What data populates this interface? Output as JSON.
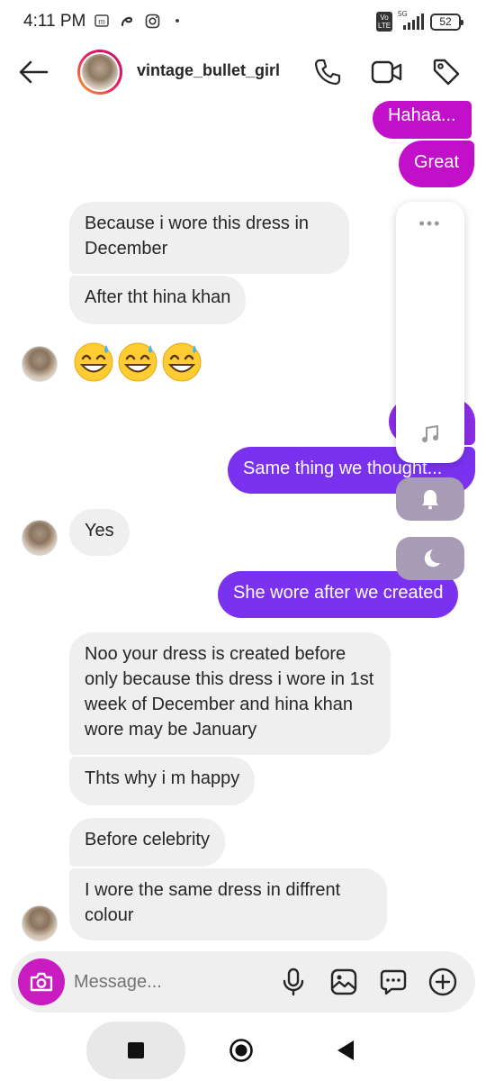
{
  "status_bar": {
    "time": "4:11 PM",
    "network": "5G",
    "volte": "Vo LTE",
    "battery": "52"
  },
  "header": {
    "username": "vintage_bullet_girl"
  },
  "messages": [
    {
      "sender": "me",
      "text": "Hahaa..."
    },
    {
      "sender": "me",
      "text": "Great"
    },
    {
      "sender": "them",
      "text": "Because i wore this dress in December"
    },
    {
      "sender": "them",
      "text": "After tht hina khan"
    },
    {
      "sender": "them",
      "text": "😅😅😅"
    },
    {
      "sender": "me",
      "text": "Same thing we thought..."
    },
    {
      "sender": "them",
      "text": "Yes"
    },
    {
      "sender": "me",
      "text": "She wore after we created"
    },
    {
      "sender": "them",
      "text": "Noo your dress is created before only because this dress i wore in 1st week of December and hina khan wore may be January"
    },
    {
      "sender": "them",
      "text": "Thts why i m happy"
    },
    {
      "sender": "them",
      "text": "Before celebrity"
    },
    {
      "sender": "them",
      "text": "I wore the same dress in diffrent colour"
    }
  ],
  "side_panel": {
    "dots": "•••"
  },
  "composer": {
    "placeholder": "Message..."
  },
  "colors": {
    "pink_bubble": "#c20fca",
    "purple_bubble": "#7a32f0",
    "incoming_bubble": "#efefef",
    "camera_button": "#c81bc0"
  }
}
